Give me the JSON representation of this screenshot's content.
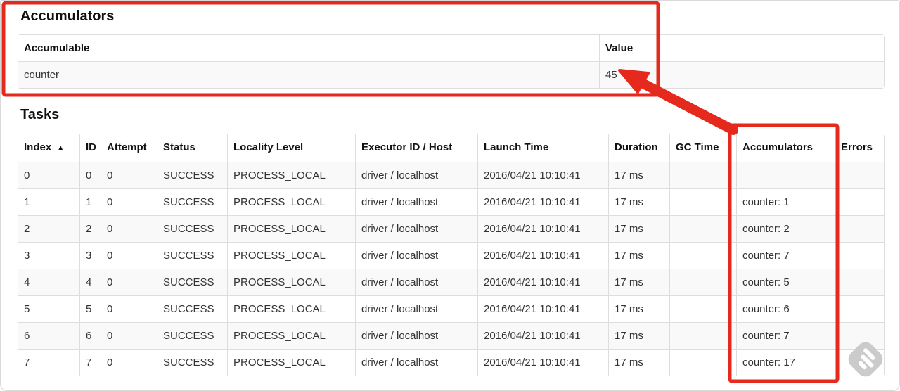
{
  "accumulators_section": {
    "title": "Accumulators",
    "table": {
      "headers": [
        "Accumulable",
        "Value"
      ],
      "rows": [
        [
          "counter",
          "45"
        ]
      ]
    }
  },
  "tasks_section": {
    "title": "Tasks",
    "table": {
      "headers": [
        "Index",
        "ID",
        "Attempt",
        "Status",
        "Locality Level",
        "Executor ID / Host",
        "Launch Time",
        "Duration",
        "GC Time",
        "Accumulators",
        "Errors"
      ],
      "sort": {
        "column": "Index",
        "direction": "ascending",
        "icon": "▲"
      },
      "rows": [
        [
          "0",
          "0",
          "0",
          "SUCCESS",
          "PROCESS_LOCAL",
          "driver / localhost",
          "2016/04/21 10:10:41",
          "17 ms",
          "",
          "",
          ""
        ],
        [
          "1",
          "1",
          "0",
          "SUCCESS",
          "PROCESS_LOCAL",
          "driver / localhost",
          "2016/04/21 10:10:41",
          "17 ms",
          "",
          "counter: 1",
          ""
        ],
        [
          "2",
          "2",
          "0",
          "SUCCESS",
          "PROCESS_LOCAL",
          "driver / localhost",
          "2016/04/21 10:10:41",
          "17 ms",
          "",
          "counter: 2",
          ""
        ],
        [
          "3",
          "3",
          "0",
          "SUCCESS",
          "PROCESS_LOCAL",
          "driver / localhost",
          "2016/04/21 10:10:41",
          "17 ms",
          "",
          "counter: 7",
          ""
        ],
        [
          "4",
          "4",
          "0",
          "SUCCESS",
          "PROCESS_LOCAL",
          "driver / localhost",
          "2016/04/21 10:10:41",
          "17 ms",
          "",
          "counter: 5",
          ""
        ],
        [
          "5",
          "5",
          "0",
          "SUCCESS",
          "PROCESS_LOCAL",
          "driver / localhost",
          "2016/04/21 10:10:41",
          "17 ms",
          "",
          "counter: 6",
          ""
        ],
        [
          "6",
          "6",
          "0",
          "SUCCESS",
          "PROCESS_LOCAL",
          "driver / localhost",
          "2016/04/21 10:10:41",
          "17 ms",
          "",
          "counter: 7",
          ""
        ],
        [
          "7",
          "7",
          "0",
          "SUCCESS",
          "PROCESS_LOCAL",
          "driver / localhost",
          "2016/04/21 10:10:41",
          "17 ms",
          "",
          "counter: 17",
          ""
        ]
      ]
    }
  },
  "annotations": {
    "highlight_color": "#e5291d",
    "items": [
      "box-around-accumulators-section",
      "box-around-accumulators-column",
      "arrow-from-column-to-total-value"
    ]
  },
  "watermark": {
    "icon": "feedly-watermark-icon",
    "color": "#c9c9c9"
  }
}
